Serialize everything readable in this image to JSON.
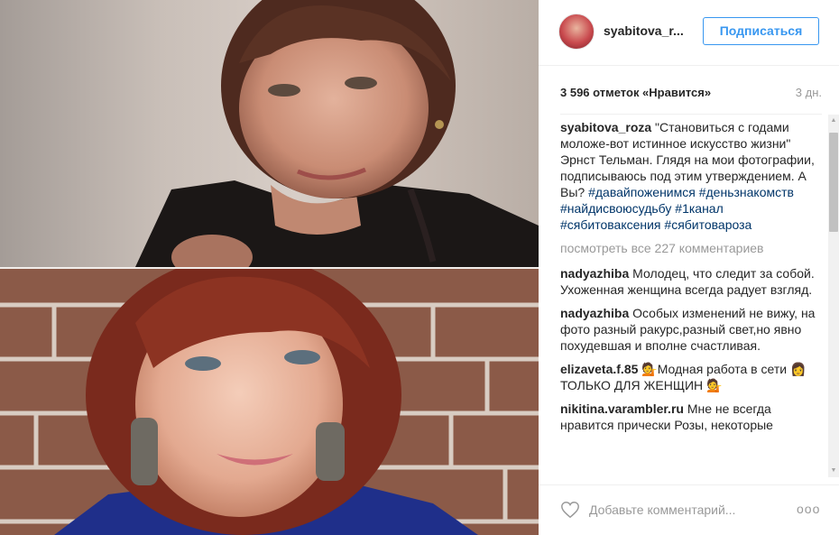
{
  "post": {
    "username": "syabitova_r...",
    "follow_label": "Подписаться",
    "likes": "3 596 отметок «Нравится»",
    "time_ago": "3 дн."
  },
  "caption": {
    "user": "syabitova_roza",
    "text": " \"Становиться с годами моложе-вот истинное искусство жизни\" Эрнст Тельман. Глядя на мои фотографии, подписываюсь под этим утверждением. А Вы? ",
    "hashtags": [
      "#давайпоженимся",
      "#деньзнакомств",
      "#найдисвоюсудьбу",
      "#1канал",
      "#сябитоваксения",
      "#сябитовароза"
    ]
  },
  "view_all": "посмотреть все 227 комментариев",
  "comments": [
    {
      "user": "nadyazhiba",
      "text": " Молодец, что следит за собой. Ухоженная женщина всегда радует взгляд."
    },
    {
      "user": "nadyazhiba",
      "text": " Особых изменений не вижу, на фото разный ракурс,разный свет,но явно похудевшая и вполне счастливая."
    },
    {
      "user": "elizaveta.f.85",
      "text": " 💁Модная работа в сети 👩ТОЛЬКО ДЛЯ ЖЕНЩИН 💁"
    },
    {
      "user": "nikitina.varambler.ru",
      "text": " Мне не всегда нравится прически Розы, некоторые"
    }
  ],
  "footer": {
    "comment_placeholder": "Добавьте комментарий...",
    "more_label": "ooo"
  },
  "colors": {
    "accent": "#3897f0",
    "hashtag": "#003569",
    "muted": "#999999"
  }
}
